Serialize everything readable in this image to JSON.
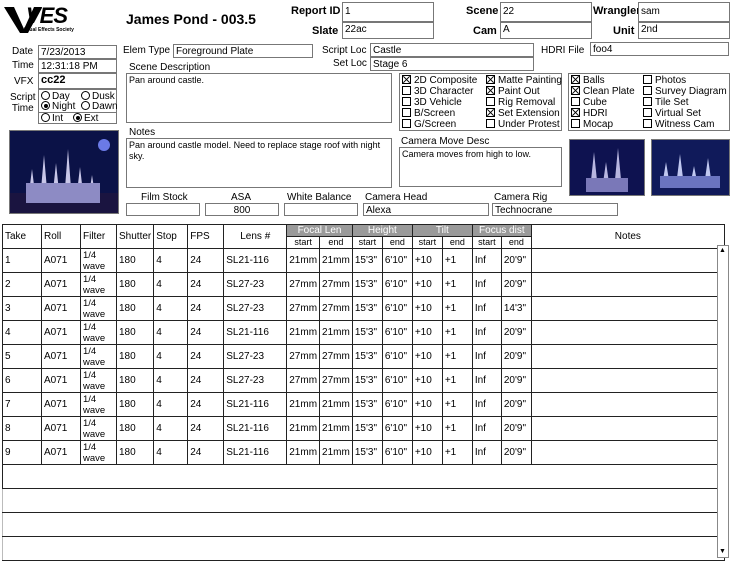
{
  "header": {
    "logo_text": "VES",
    "logo_sub": "Visual Effects Society",
    "title": "James Pond - 003.5",
    "report_id_label": "Report ID",
    "report_id": "1",
    "scene_label": "Scene",
    "scene": "22",
    "wrangler_label": "Wrangler",
    "wrangler": "sam",
    "slate_label": "Slate",
    "slate": "22ac",
    "cam_label": "Cam",
    "cam": "A",
    "unit_label": "Unit",
    "unit": "2nd"
  },
  "info": {
    "date_label": "Date",
    "date": "7/23/2013",
    "time_label": "Time",
    "time": "12:31:18 PM",
    "vfx_label": "VFX",
    "vfx": "cc22",
    "script_time_label": "Script\nTime",
    "day": "Day",
    "dusk": "Dusk",
    "night": "Night",
    "dawn": "Dawn",
    "int": "Int",
    "ext": "Ext",
    "elem_type_label": "Elem Type",
    "elem_type": "Foreground Plate",
    "script_loc_label": "Script Loc",
    "script_loc": "Castle",
    "set_loc_label": "Set Loc",
    "set_loc": "Stage 6",
    "hdri_label": "HDRI File",
    "hdri": "foo4",
    "scene_desc_label": "Scene Description",
    "scene_desc": "Pan around castle.",
    "notes_label": "Notes",
    "notes": "Pan around castle model. Need to replace stage roof with night sky.",
    "cam_move_label": "Camera Move Desc",
    "cam_move": "Camera moves from high to low."
  },
  "checks1": [
    {
      "label": "2D Composite",
      "on": true
    },
    {
      "label": "3D Character",
      "on": false
    },
    {
      "label": "3D Vehicle",
      "on": false
    },
    {
      "label": "B/Screen",
      "on": false
    },
    {
      "label": "G/Screen",
      "on": false
    }
  ],
  "checks2": [
    {
      "label": "Matte Painting",
      "on": true
    },
    {
      "label": "Paint Out",
      "on": true
    },
    {
      "label": "Rig Removal",
      "on": false
    },
    {
      "label": "Set Extension",
      "on": true
    },
    {
      "label": "Under Protest",
      "on": false
    }
  ],
  "checks3": [
    {
      "label": "Balls",
      "on": true
    },
    {
      "label": "Clean Plate",
      "on": true
    },
    {
      "label": "Cube",
      "on": false
    },
    {
      "label": "HDRI",
      "on": true
    },
    {
      "label": "Mocap",
      "on": false
    }
  ],
  "checks4": [
    {
      "label": "Photos",
      "on": false
    },
    {
      "label": "Survey Diagram",
      "on": false
    },
    {
      "label": "Tile Set",
      "on": false
    },
    {
      "label": "Virtual Set",
      "on": false
    },
    {
      "label": "Witness Cam",
      "on": false
    }
  ],
  "camera": {
    "film_stock_label": "Film Stock",
    "film_stock": "",
    "asa_label": "ASA",
    "asa": "800",
    "wb_label": "White Balance",
    "wb": "",
    "head_label": "Camera Head",
    "head": "Alexa",
    "rig_label": "Camera Rig",
    "rig": "Technocrane"
  },
  "table": {
    "columns": [
      "Take",
      "Roll",
      "Filter",
      "Shutter",
      "Stop",
      "FPS",
      "Lens #"
    ],
    "groups": [
      "Focal Len",
      "Height",
      "Tilt",
      "Focus dist"
    ],
    "start": "start",
    "end": "end",
    "notes_label": "Notes",
    "rows": [
      [
        "1",
        "A071",
        "1/4 wave",
        "180",
        "4",
        "24",
        "SL21-116",
        "21mm",
        "21mm",
        "15'3\"",
        "6'10\"",
        "+10",
        "+1",
        "Inf",
        "20'9\""
      ],
      [
        "2",
        "A071",
        "1/4 wave",
        "180",
        "4",
        "24",
        "SL27-23",
        "27mm",
        "27mm",
        "15'3\"",
        "6'10\"",
        "+10",
        "+1",
        "Inf",
        "20'9\""
      ],
      [
        "3",
        "A071",
        "1/4 wave",
        "180",
        "4",
        "24",
        "SL27-23",
        "27mm",
        "27mm",
        "15'3\"",
        "6'10\"",
        "+10",
        "+1",
        "Inf",
        "14'3\""
      ],
      [
        "4",
        "A071",
        "1/4 wave",
        "180",
        "4",
        "24",
        "SL21-116",
        "21mm",
        "21mm",
        "15'3\"",
        "6'10\"",
        "+10",
        "+1",
        "Inf",
        "20'9\""
      ],
      [
        "5",
        "A071",
        "1/4 wave",
        "180",
        "4",
        "24",
        "SL27-23",
        "27mm",
        "27mm",
        "15'3\"",
        "6'10\"",
        "+10",
        "+1",
        "Inf",
        "20'9\""
      ],
      [
        "6",
        "A071",
        "1/4 wave",
        "180",
        "4",
        "24",
        "SL27-23",
        "27mm",
        "27mm",
        "15'3\"",
        "6'10\"",
        "+10",
        "+1",
        "Inf",
        "20'9\""
      ],
      [
        "7",
        "A071",
        "1/4 wave",
        "180",
        "4",
        "24",
        "SL21-116",
        "21mm",
        "21mm",
        "15'3\"",
        "6'10\"",
        "+10",
        "+1",
        "Inf",
        "20'9\""
      ],
      [
        "8",
        "A071",
        "1/4 wave",
        "180",
        "4",
        "24",
        "SL21-116",
        "21mm",
        "21mm",
        "15'3\"",
        "6'10\"",
        "+10",
        "+1",
        "Inf",
        "20'9\""
      ],
      [
        "9",
        "A071",
        "1/4 wave",
        "180",
        "4",
        "24",
        "SL21-116",
        "21mm",
        "21mm",
        "15'3\"",
        "6'10\"",
        "+10",
        "+1",
        "Inf",
        "20'9\""
      ]
    ]
  }
}
